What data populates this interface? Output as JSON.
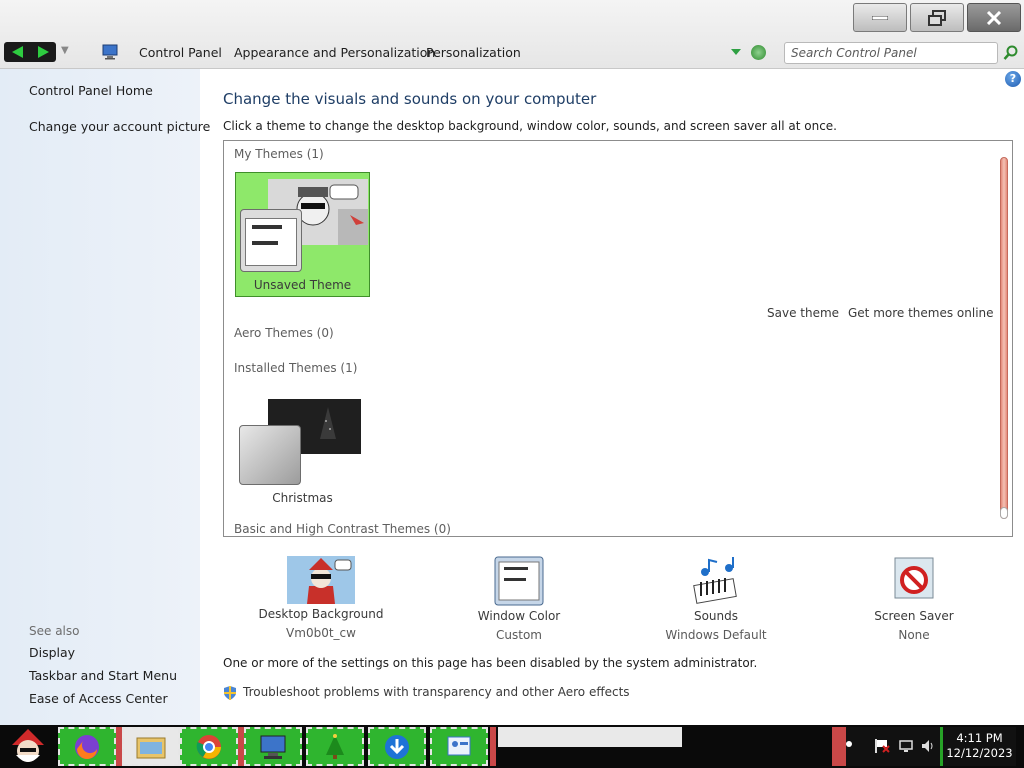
{
  "breadcrumb": [
    "Control Panel",
    "Appearance and Personalization",
    "Personalization"
  ],
  "search": {
    "placeholder": "Search Control Panel"
  },
  "help_label": "?",
  "sidebar": {
    "links": [
      "Control Panel Home",
      "Change your account picture"
    ],
    "see_also_title": "See also",
    "see_also": [
      "Display",
      "Taskbar and Start Menu",
      "Ease of Access Center"
    ]
  },
  "main": {
    "title": "Change the visuals and sounds on your computer",
    "subtitle": "Click a theme to change the desktop background, window color, sounds, and screen saver all at once.",
    "sections": {
      "my_themes": "My Themes (1)",
      "aero_themes": "Aero Themes (0)",
      "installed_themes": "Installed Themes (1)",
      "basic_themes": "Basic and High Contrast Themes (0)"
    },
    "themes": {
      "unsaved": "Unsaved Theme",
      "christmas": "Christmas"
    },
    "actions": {
      "save_theme": "Save theme",
      "get_more": "Get more themes online"
    },
    "settings": [
      {
        "label": "Desktop Background",
        "value": "Vm0b0t_cw"
      },
      {
        "label": "Window Color",
        "value": "Custom"
      },
      {
        "label": "Sounds",
        "value": "Windows Default"
      },
      {
        "label": "Screen Saver",
        "value": "None"
      }
    ],
    "notice": "One or more of the settings on this page has been disabled by the system administrator.",
    "troubleshoot": "Troubleshoot problems with transparency and other Aero effects"
  },
  "taskbar": {
    "time": "4:11 PM",
    "date": "12/12/2023"
  }
}
